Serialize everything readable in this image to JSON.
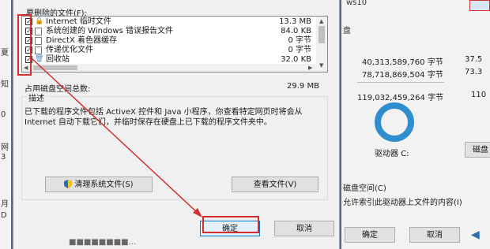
{
  "cleanup_dialog": {
    "files_to_delete_label": "要删除的文件(F):",
    "files": [
      {
        "checked": true,
        "icon": "lock-icon",
        "name": "Internet 临时文件",
        "size": "13.3 MB"
      },
      {
        "checked": true,
        "icon": "file-icon",
        "name": "系统创建的 Windows 错误报告文件",
        "size": "84.0 KB"
      },
      {
        "checked": true,
        "icon": "file-icon",
        "name": "DirectX 着色器缓存",
        "size": "0 字节"
      },
      {
        "checked": true,
        "icon": "file-icon",
        "name": "传递优化文件",
        "size": "0 字节"
      },
      {
        "checked": true,
        "icon": "recycle-bin-icon",
        "name": "回收站",
        "size": "32.0 KB"
      }
    ],
    "space_label": "占用磁盘空间总数:",
    "space_value": "29.9 MB",
    "description_title": "描述",
    "description_text": "已下载的程序文件包括 ActiveX 控件和 Java 小程序，你查看特定网页时将会从 Internet 自动下载它们，并临时保存在硬盘上已下载的程序文件夹中。",
    "clean_system_files_button": "清理系统文件(S)",
    "view_files_button": "查看文件(V)",
    "ok_button": "确定",
    "cancel_button": "取消",
    "bottom_partial_text": "■■■■■■■■..."
  },
  "background_window": {
    "title_fragment": "ws10",
    "tab_fragment": "盘",
    "rows": [
      {
        "value": "40,313,589,760 字节",
        "extra": "37.5"
      },
      {
        "value": "78,718,869,504 字节",
        "extra": "73.3"
      },
      {
        "value": "119,032,459,264 字节",
        "extra": "110"
      }
    ],
    "drive_label": "驱动器 C:",
    "disk_cleanup_button": "磁盘",
    "compress_label": "磁盘空间(C)",
    "index_label": "允许索引此驱动器上文件的内容(I)",
    "ok_button": "确定",
    "cancel_button": "取消"
  },
  "left_strip_chars": [
    "夏",
    "知",
    "0",
    "网",
    "3",
    "月",
    "D"
  ],
  "colors": {
    "highlight_red": "#d32f2f",
    "disk_used_blue": "#2f8ecf",
    "disk_free_gray": "#cfcfcf"
  }
}
